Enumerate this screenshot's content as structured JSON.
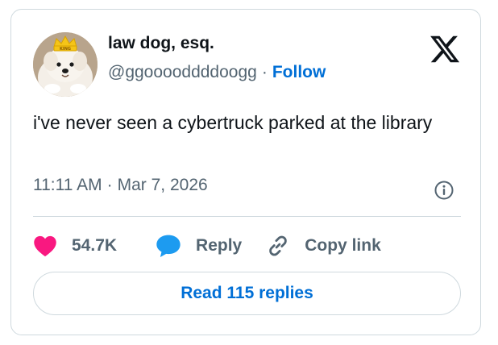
{
  "author": {
    "name": "law dog, esq.",
    "handle": "@ggooooddddoogg",
    "separator": "·",
    "follow_label": "Follow",
    "avatar_badge": "KING"
  },
  "tweet": {
    "text": "i've never seen a cybertruck parked at the library",
    "time": "11:11 AM",
    "date": "Mar 7, 2026",
    "separator": "·"
  },
  "actions": {
    "likes_count": "54.7K",
    "reply_label": "Reply",
    "copy_link_label": "Copy link"
  },
  "read_replies_label": "Read 115 replies",
  "icons": {
    "logo": "x-logo-icon",
    "info": "info-icon",
    "like": "heart-icon",
    "reply": "speech-bubble-icon",
    "copy": "link-icon"
  },
  "colors": {
    "link_blue": "#006fd6",
    "heart_pink": "#f91880",
    "reply_blue": "#1d9bf0",
    "muted_text": "#536471",
    "border": "#cfd9de"
  }
}
